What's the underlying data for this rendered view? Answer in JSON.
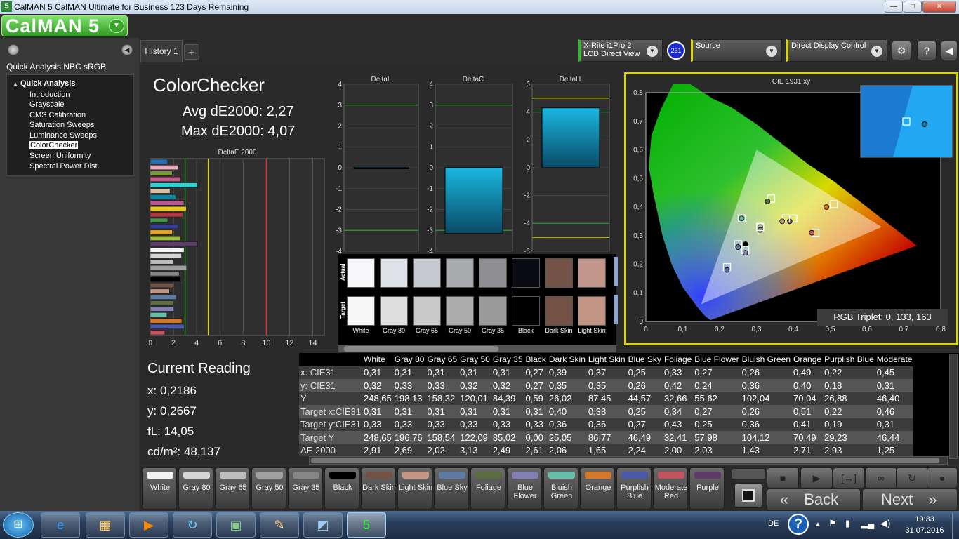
{
  "window": {
    "title": "CalMAN 5 CalMAN Ultimate for Business 123 Days Remaining",
    "app_icon": "5",
    "min": "—",
    "max": "□",
    "close": "✕"
  },
  "logo": {
    "text": "CalMAN 5"
  },
  "sidebar": {
    "title": "Quick Analysis NBC sRGB",
    "root": "Quick Analysis",
    "items": [
      "Introduction",
      "Grayscale",
      "CMS Calibration",
      "Saturation Sweeps",
      "Luminance Sweeps",
      "ColorChecker",
      "Screen Uniformity",
      "Spectral Power Dist."
    ],
    "selected": "ColorChecker"
  },
  "tabs": {
    "history": "History 1",
    "add": "+"
  },
  "devices": {
    "meter_line1": "X-Rite i1Pro 2",
    "meter_line2": "LCD Direct View",
    "meter_badge": "231",
    "source": "Source",
    "display": "Direct Display Control"
  },
  "page": {
    "title": "ColorChecker",
    "avg": "Avg dE2000: 2,27",
    "max": "Max dE2000: 4,07"
  },
  "deltae_chart": {
    "title": "DeltaE 2000",
    "ticks": [
      "0",
      "2",
      "4",
      "6",
      "8",
      "10",
      "12",
      "14"
    ]
  },
  "delta_charts": [
    {
      "title": "DeltaL",
      "ticks": [
        "4",
        "3",
        "2",
        "1",
        "0",
        "-1",
        "-2",
        "-3",
        "-4"
      ]
    },
    {
      "title": "DeltaC",
      "ticks": [
        "4",
        "3",
        "2",
        "1",
        "0",
        "-1",
        "-2",
        "-3",
        "-4"
      ]
    },
    {
      "title": "DeltaH",
      "ticks": [
        "6",
        "4",
        "2",
        "0",
        "-2",
        "-4",
        "-6"
      ]
    }
  ],
  "swatches": {
    "actual_label": "Actual",
    "target_label": "Target",
    "items": [
      {
        "name": "White",
        "actual": "#f8f8fb",
        "target": "#f7f7f7"
      },
      {
        "name": "Gray 80",
        "actual": "#dfe2e6",
        "target": "#dedede"
      },
      {
        "name": "Gray 65",
        "actual": "#c6c9cd",
        "target": "#c9c9c9"
      },
      {
        "name": "Gray 50",
        "actual": "#a9aaae",
        "target": "#acacac"
      },
      {
        "name": "Gray 35",
        "actual": "#8d8d92",
        "target": "#9a9a9a"
      },
      {
        "name": "Black",
        "actual": "#0a0a12",
        "target": "#000000"
      },
      {
        "name": "Dark Skin",
        "actual": "#735348",
        "target": "#735245"
      },
      {
        "name": "Light Skin",
        "actual": "#c2968a",
        "target": "#c29584"
      }
    ]
  },
  "current": {
    "title": "Current Reading",
    "x": "x: 0,2186",
    "y": "y: 0,2667",
    "fl": "fL: 14,05",
    "cdm": "cd/m²: 48,137"
  },
  "table": {
    "columns": [
      "",
      "White",
      "Gray 80",
      "Gray 65",
      "Gray 50",
      "Gray 35",
      "Black",
      "Dark Skin",
      "Light Skin",
      "Blue Sky",
      "Foliage",
      "Blue Flower",
      "Bluish Green",
      "Orange",
      "Purplish Blue",
      "Moderate"
    ],
    "rows": [
      [
        "x: CIE31",
        "0,31",
        "0,31",
        "0,31",
        "0,31",
        "0,31",
        "0,27",
        "0,39",
        "0,37",
        "0,25",
        "0,33",
        "0,27",
        "0,26",
        "0,49",
        "0,22",
        "0,45"
      ],
      [
        "y: CIE31",
        "0,32",
        "0,33",
        "0,33",
        "0,32",
        "0,32",
        "0,27",
        "0,35",
        "0,35",
        "0,26",
        "0,42",
        "0,24",
        "0,36",
        "0,40",
        "0,18",
        "0,31"
      ],
      [
        "Y",
        "248,65",
        "198,13",
        "158,32",
        "120,01",
        "84,39",
        "0,59",
        "26,02",
        "87,45",
        "44,57",
        "32,66",
        "55,62",
        "102,04",
        "70,04",
        "26,88",
        "46,40"
      ],
      [
        "Target x:CIE31",
        "0,31",
        "0,31",
        "0,31",
        "0,31",
        "0,31",
        "0,31",
        "0,40",
        "0,38",
        "0,25",
        "0,34",
        "0,27",
        "0,26",
        "0,51",
        "0,22",
        "0,46"
      ],
      [
        "Target y:CIE31",
        "0,33",
        "0,33",
        "0,33",
        "0,33",
        "0,33",
        "0,33",
        "0,36",
        "0,36",
        "0,27",
        "0,43",
        "0,25",
        "0,36",
        "0,41",
        "0,19",
        "0,31"
      ],
      [
        "Target Y",
        "248,65",
        "196,76",
        "158,54",
        "122,09",
        "85,02",
        "0,00",
        "25,05",
        "86,77",
        "46,49",
        "32,41",
        "57,98",
        "104,12",
        "70,49",
        "29,23",
        "46,44"
      ],
      [
        "ΔE 2000",
        "2,91",
        "2,69",
        "2,02",
        "3,13",
        "2,49",
        "2,61",
        "2,06",
        "1,65",
        "2,24",
        "2,00",
        "2,03",
        "1,43",
        "2,71",
        "2,93",
        "1,25"
      ]
    ]
  },
  "cie": {
    "title": "CIE 1931 xy",
    "triplet": "RGB Triplet: 0, 133, 163",
    "xticks": [
      "0",
      "0,1",
      "0,2",
      "0,3",
      "0,4",
      "0,5",
      "0,6",
      "0,7",
      "0,8"
    ],
    "yticks": [
      "0,8",
      "0,7",
      "0,6",
      "0,5",
      "0,4",
      "0,3",
      "0,2",
      "0,1",
      "0"
    ]
  },
  "patches": [
    {
      "label": "White",
      "color": "#f2f2f2"
    },
    {
      "label": "Gray 80",
      "color": "#d6d6d6"
    },
    {
      "label": "Gray 65",
      "color": "#bdbdbd"
    },
    {
      "label": "Gray 50",
      "color": "#a0a0a0"
    },
    {
      "label": "Gray 35",
      "color": "#868686"
    },
    {
      "label": "Black",
      "color": "#000000"
    },
    {
      "label": "Dark Skin",
      "color": "#735245"
    },
    {
      "label": "Light Skin",
      "color": "#c29584"
    },
    {
      "label": "Blue Sky",
      "color": "#5e7ba4"
    },
    {
      "label": "Foliage",
      "color": "#5b6c40"
    },
    {
      "label": "Blue Flower",
      "color": "#8280b2"
    },
    {
      "label": "Bluish Green",
      "color": "#66bdaa"
    },
    {
      "label": "Orange",
      "color": "#d4782c"
    },
    {
      "label": "Purplish Blue",
      "color": "#4b5aa6"
    },
    {
      "label": "Moderate Red",
      "color": "#c1545e"
    },
    {
      "label": "Purple",
      "color": "#5d3c6b"
    }
  ],
  "controls": {
    "back": "Back",
    "next": "Next"
  },
  "taskbar": {
    "lang": "DE",
    "time": "19:33",
    "date": "31.07.2016"
  }
}
